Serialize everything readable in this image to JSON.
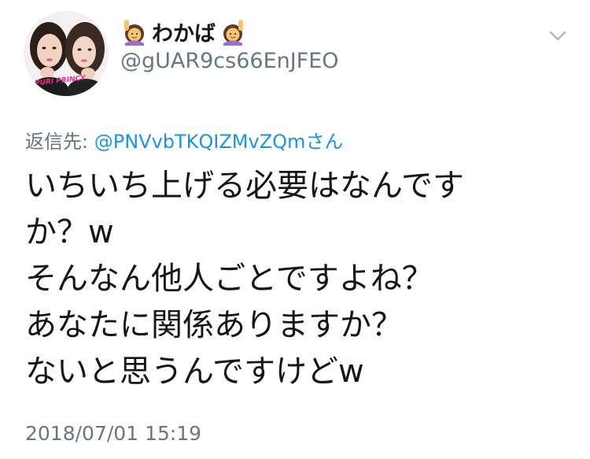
{
  "header": {
    "display_name": "わかば",
    "handle": "@gUAR9cs66EnJFEO",
    "avatar_caption": "PURI PRINCY"
  },
  "reply": {
    "prefix": "返信先: ",
    "mention": "@PNVvbTKQIZMvZQm",
    "suffix": "さん"
  },
  "tweet": {
    "lines": [
      "いちいち上げる必要はなんです",
      "か？w",
      "そんなん他人ごとですよね？",
      "あなたに関係ありますか？",
      "ないと思うんですけどw"
    ]
  },
  "timestamp": "2018/07/01 15:19",
  "colors": {
    "link": "#1b95e0",
    "secondary_text": "#657786",
    "primary_text": "#14171a"
  },
  "icons": {
    "name_left": "person-raising-hand-emoji",
    "name_right": "person-raising-hand-emoji",
    "menu": "chevron-down-icon"
  }
}
